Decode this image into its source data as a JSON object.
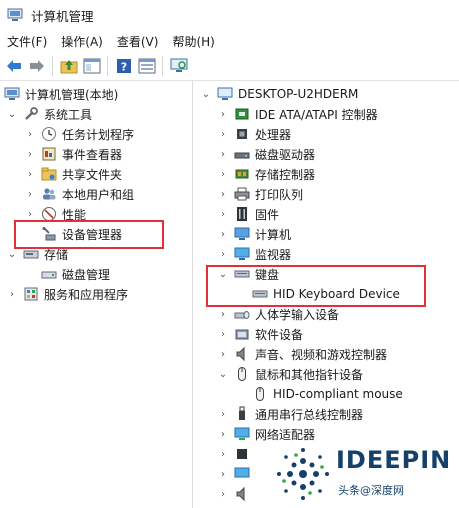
{
  "window": {
    "title": "计算机管理"
  },
  "menu": [
    "文件(F)",
    "操作(A)",
    "查看(V)",
    "帮助(H)"
  ],
  "left_tree": {
    "root": "计算机管理(本地)",
    "system_tools": "系统工具",
    "task_scheduler": "任务计划程序",
    "event_viewer": "事件查看器",
    "shared_folders": "共享文件夹",
    "local_users": "本地用户和组",
    "performance": "性能",
    "device_manager": "设备管理器",
    "storage": "存储",
    "disk_management": "磁盘管理",
    "services": "服务和应用程序"
  },
  "device_tree": {
    "root": "DESKTOP-U2HDERM",
    "ide": "IDE ATA/ATAPI 控制器",
    "processors": "处理器",
    "disk_drives": "磁盘驱动器",
    "storage_controllers": "存储控制器",
    "print_queues": "打印队列",
    "firmware": "固件",
    "computer": "计算机",
    "monitors": "监视器",
    "keyboards": "键盘",
    "hid_keyboard": "HID Keyboard Device",
    "hid": "人体学输入设备",
    "software_devices": "软件设备",
    "sound": "声音、视频和游戏控制器",
    "mice": "鼠标和其他指针设备",
    "hid_mouse": "HID-compliant mouse",
    "usb": "通用串行总线控制器",
    "network": "网络适配器"
  },
  "watermark": {
    "brand": "IDEEPIN",
    "sub": "头条@深度网"
  }
}
